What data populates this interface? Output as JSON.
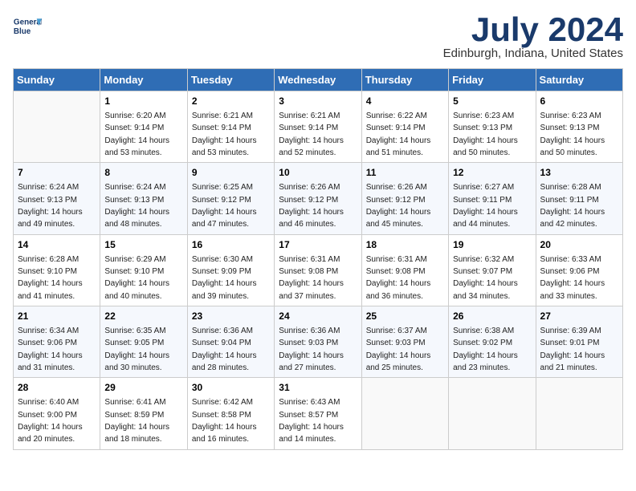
{
  "header": {
    "logo_line1": "General",
    "logo_line2": "Blue",
    "month": "July 2024",
    "location": "Edinburgh, Indiana, United States"
  },
  "weekdays": [
    "Sunday",
    "Monday",
    "Tuesday",
    "Wednesday",
    "Thursday",
    "Friday",
    "Saturday"
  ],
  "weeks": [
    [
      {
        "day": "",
        "info": ""
      },
      {
        "day": "1",
        "info": "Sunrise: 6:20 AM\nSunset: 9:14 PM\nDaylight: 14 hours\nand 53 minutes."
      },
      {
        "day": "2",
        "info": "Sunrise: 6:21 AM\nSunset: 9:14 PM\nDaylight: 14 hours\nand 53 minutes."
      },
      {
        "day": "3",
        "info": "Sunrise: 6:21 AM\nSunset: 9:14 PM\nDaylight: 14 hours\nand 52 minutes."
      },
      {
        "day": "4",
        "info": "Sunrise: 6:22 AM\nSunset: 9:14 PM\nDaylight: 14 hours\nand 51 minutes."
      },
      {
        "day": "5",
        "info": "Sunrise: 6:23 AM\nSunset: 9:13 PM\nDaylight: 14 hours\nand 50 minutes."
      },
      {
        "day": "6",
        "info": "Sunrise: 6:23 AM\nSunset: 9:13 PM\nDaylight: 14 hours\nand 50 minutes."
      }
    ],
    [
      {
        "day": "7",
        "info": "Sunrise: 6:24 AM\nSunset: 9:13 PM\nDaylight: 14 hours\nand 49 minutes."
      },
      {
        "day": "8",
        "info": "Sunrise: 6:24 AM\nSunset: 9:13 PM\nDaylight: 14 hours\nand 48 minutes."
      },
      {
        "day": "9",
        "info": "Sunrise: 6:25 AM\nSunset: 9:12 PM\nDaylight: 14 hours\nand 47 minutes."
      },
      {
        "day": "10",
        "info": "Sunrise: 6:26 AM\nSunset: 9:12 PM\nDaylight: 14 hours\nand 46 minutes."
      },
      {
        "day": "11",
        "info": "Sunrise: 6:26 AM\nSunset: 9:12 PM\nDaylight: 14 hours\nand 45 minutes."
      },
      {
        "day": "12",
        "info": "Sunrise: 6:27 AM\nSunset: 9:11 PM\nDaylight: 14 hours\nand 44 minutes."
      },
      {
        "day": "13",
        "info": "Sunrise: 6:28 AM\nSunset: 9:11 PM\nDaylight: 14 hours\nand 42 minutes."
      }
    ],
    [
      {
        "day": "14",
        "info": "Sunrise: 6:28 AM\nSunset: 9:10 PM\nDaylight: 14 hours\nand 41 minutes."
      },
      {
        "day": "15",
        "info": "Sunrise: 6:29 AM\nSunset: 9:10 PM\nDaylight: 14 hours\nand 40 minutes."
      },
      {
        "day": "16",
        "info": "Sunrise: 6:30 AM\nSunset: 9:09 PM\nDaylight: 14 hours\nand 39 minutes."
      },
      {
        "day": "17",
        "info": "Sunrise: 6:31 AM\nSunset: 9:08 PM\nDaylight: 14 hours\nand 37 minutes."
      },
      {
        "day": "18",
        "info": "Sunrise: 6:31 AM\nSunset: 9:08 PM\nDaylight: 14 hours\nand 36 minutes."
      },
      {
        "day": "19",
        "info": "Sunrise: 6:32 AM\nSunset: 9:07 PM\nDaylight: 14 hours\nand 34 minutes."
      },
      {
        "day": "20",
        "info": "Sunrise: 6:33 AM\nSunset: 9:06 PM\nDaylight: 14 hours\nand 33 minutes."
      }
    ],
    [
      {
        "day": "21",
        "info": "Sunrise: 6:34 AM\nSunset: 9:06 PM\nDaylight: 14 hours\nand 31 minutes."
      },
      {
        "day": "22",
        "info": "Sunrise: 6:35 AM\nSunset: 9:05 PM\nDaylight: 14 hours\nand 30 minutes."
      },
      {
        "day": "23",
        "info": "Sunrise: 6:36 AM\nSunset: 9:04 PM\nDaylight: 14 hours\nand 28 minutes."
      },
      {
        "day": "24",
        "info": "Sunrise: 6:36 AM\nSunset: 9:03 PM\nDaylight: 14 hours\nand 27 minutes."
      },
      {
        "day": "25",
        "info": "Sunrise: 6:37 AM\nSunset: 9:03 PM\nDaylight: 14 hours\nand 25 minutes."
      },
      {
        "day": "26",
        "info": "Sunrise: 6:38 AM\nSunset: 9:02 PM\nDaylight: 14 hours\nand 23 minutes."
      },
      {
        "day": "27",
        "info": "Sunrise: 6:39 AM\nSunset: 9:01 PM\nDaylight: 14 hours\nand 21 minutes."
      }
    ],
    [
      {
        "day": "28",
        "info": "Sunrise: 6:40 AM\nSunset: 9:00 PM\nDaylight: 14 hours\nand 20 minutes."
      },
      {
        "day": "29",
        "info": "Sunrise: 6:41 AM\nSunset: 8:59 PM\nDaylight: 14 hours\nand 18 minutes."
      },
      {
        "day": "30",
        "info": "Sunrise: 6:42 AM\nSunset: 8:58 PM\nDaylight: 14 hours\nand 16 minutes."
      },
      {
        "day": "31",
        "info": "Sunrise: 6:43 AM\nSunset: 8:57 PM\nDaylight: 14 hours\nand 14 minutes."
      },
      {
        "day": "",
        "info": ""
      },
      {
        "day": "",
        "info": ""
      },
      {
        "day": "",
        "info": ""
      }
    ]
  ]
}
